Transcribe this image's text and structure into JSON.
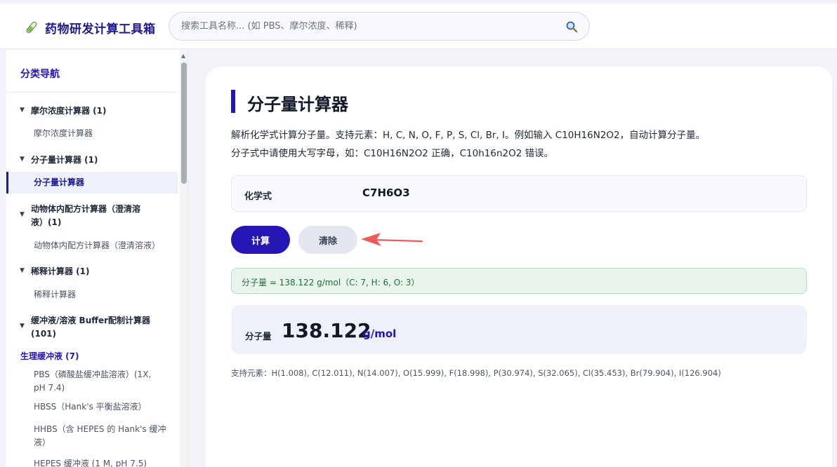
{
  "header": {
    "app_title": "药物研发计算工具箱",
    "search_placeholder": "搜索工具名称... (如 PBS、摩尔浓度、稀释)",
    "brand_icon": "test-tube-icon",
    "search_icon": "magnifier-icon"
  },
  "sidebar": {
    "heading": "分类导航",
    "groups": [
      {
        "label": "摩尔浓度计算器 (1)",
        "items": [
          "摩尔浓度计算器"
        ]
      },
      {
        "label": "分子量计算器 (1)",
        "items": [
          "分子量计算器"
        ]
      },
      {
        "label": "动物体内配方计算器（澄清溶液）(1)",
        "label_line1": "动物体内配方计算器（澄清溶",
        "label_line2": "液）(1)",
        "items": [
          "动物体内配方计算器（澄清溶液）"
        ]
      },
      {
        "label": "稀释计算器 (1)",
        "items": [
          "稀释计算器"
        ]
      },
      {
        "label": "缓冲液/溶液 Buffer配制计算器 (101)",
        "label_line1": "缓冲液/溶液 Buffer配制计算器",
        "label_line2": "(101)",
        "subheading": "生理缓冲液 (7)",
        "items": [
          {
            "line1": "PBS（磷酸盐缓冲盐溶液）(1X,",
            "line2": "pH 7.4)"
          },
          {
            "line1": "HBSS（Hank's 平衡盐溶液）"
          },
          {
            "line1": "HHBS（含 HEPES 的 Hank's 缓冲",
            "line2": "液）"
          },
          {
            "line1": "HEPES 缓冲液 (1 M, pH 7.5)"
          }
        ]
      }
    ],
    "active_item": "分子量计算器"
  },
  "main": {
    "title": "分子量计算器",
    "description_line1": "解析化学式计算分子量。支持元素：H, C, N, O, F, P, S, Cl, Br, I。例如输入 C10H16N2O2，自动计算分子量。",
    "description_line2": "分子式中请使用大写字母，如：C10H16N2O2 正确，C10h16n2O2 错误。",
    "formula_label": "化学式",
    "formula_value": "C7H6O3",
    "calc_button": "计算",
    "clear_button": "清除",
    "result_message": "分子量 = 138.122 g/mol（C: 7, H: 6, O: 3）",
    "result_label": "分子量",
    "result_value": "138.122",
    "result_unit": "g/mol",
    "supported_elements": "支持元素：H(1.008), C(12.011), N(14.007), O(15.999), F(18.998), P(30.974), S(32.065), Cl(35.453), Br(79.904), I(126.904)"
  },
  "colors": {
    "accent": "#2416b5",
    "success_bg": "#e9f5ec",
    "arrow": "#f05a5a"
  }
}
